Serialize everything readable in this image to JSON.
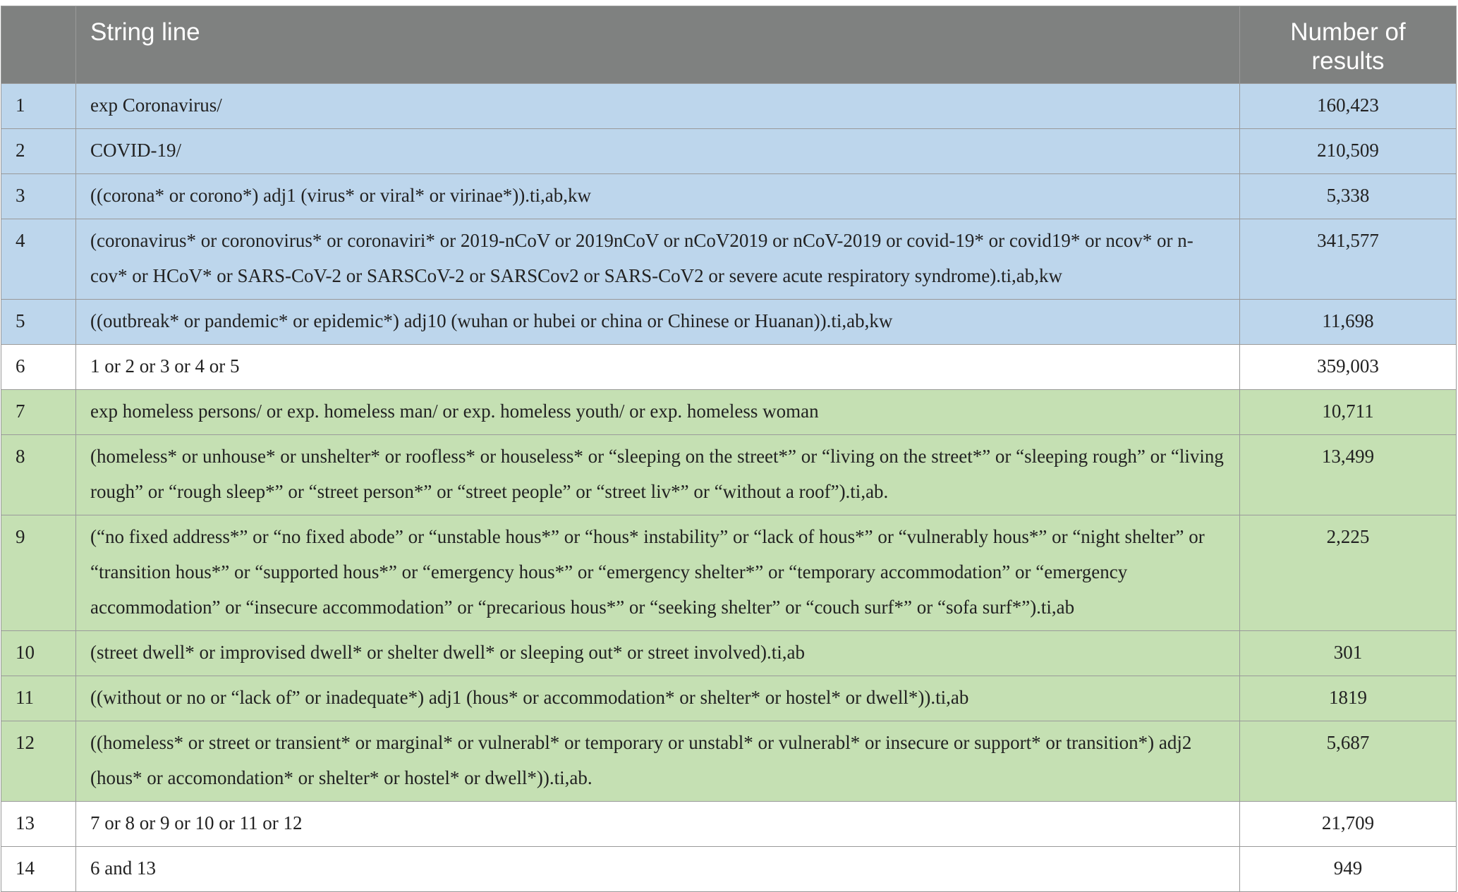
{
  "table": {
    "headers": {
      "number": "",
      "string_line": "String line",
      "results": "Number of results"
    },
    "rows": [
      {
        "n": "1",
        "string": "exp Coronavirus/",
        "results": "160,423",
        "group": "covid"
      },
      {
        "n": "2",
        "string": "COVID-19/",
        "results": "210,509",
        "group": "covid"
      },
      {
        "n": "3",
        "string": "((corona* or corono*) adj1 (virus* or viral* or virinae*)).ti,ab,kw",
        "results": "5,338",
        "group": "covid"
      },
      {
        "n": "4",
        "string": "(coronavirus* or coronovirus* or coronaviri* or 2019-nCoV or 2019nCoV or nCoV2019 or nCoV-2019 or covid-19* or covid19* or ncov* or n-cov* or HCoV* or SARS-CoV-2 or SARSCoV-2 or SARSCov2 or SARS-CoV2 or severe acute respiratory syndrome).ti,ab,kw",
        "results": "341,577",
        "group": "covid"
      },
      {
        "n": "5",
        "string": "((outbreak* or pandemic* or epidemic*) adj10 (wuhan or hubei or china or Chinese or Huanan)).ti,ab,kw",
        "results": "11,698",
        "group": "covid"
      },
      {
        "n": "6",
        "string": "1 or 2 or 3 or 4 or 5",
        "results": "359,003",
        "group": "plain"
      },
      {
        "n": "7",
        "string": "exp homeless persons/ or exp. homeless man/ or exp. homeless youth/ or exp. homeless woman",
        "results": "10,711",
        "group": "homeless"
      },
      {
        "n": "8",
        "string": "(homeless* or unhouse* or unshelter* or roofless* or houseless* or “sleeping on the street*” or “living on the street*” or “sleeping rough” or “living rough” or “rough sleep*” or “street person*” or “street people” or “street liv*” or “without a roof”).ti,ab.",
        "results": "13,499",
        "group": "homeless"
      },
      {
        "n": "9",
        "string": "(“no fixed address*” or “no fixed abode” or “unstable hous*” or “hous* instability” or “lack of hous*” or “vulnerably hous*” or “night shelter” or “transition hous*” or “supported hous*” or “emergency hous*” or “emergency shelter*” or “temporary accommodation” or “emergency accommodation” or “insecure accommodation” or “precarious hous*” or “seeking shelter” or “couch surf*” or “sofa surf*”).ti,ab",
        "results": "2,225",
        "group": "homeless"
      },
      {
        "n": "10",
        "string": "(street dwell* or improvised dwell* or shelter dwell* or sleeping out* or street involved).ti,ab",
        "results": "301",
        "group": "homeless"
      },
      {
        "n": "11",
        "string": "((without or no or “lack of” or inadequate*) adj1 (hous* or accommodation* or shelter* or hostel* or dwell*)).ti,ab",
        "results": "1819",
        "group": "homeless"
      },
      {
        "n": "12",
        "string": "((homeless* or street or transient* or marginal* or vulnerabl* or temporary or unstabl* or vulnerabl* or insecure or support* or transition*) adj2 (hous* or accomondation* or shelter* or hostel* or dwell*)).ti,ab.",
        "results": "5,687",
        "group": "homeless"
      },
      {
        "n": "13",
        "string": "7 or 8 or 9 or 10 or 11 or 12",
        "results": "21,709",
        "group": "plain"
      },
      {
        "n": "14",
        "string": "6 and 13",
        "results": "949",
        "group": "plain"
      }
    ]
  }
}
